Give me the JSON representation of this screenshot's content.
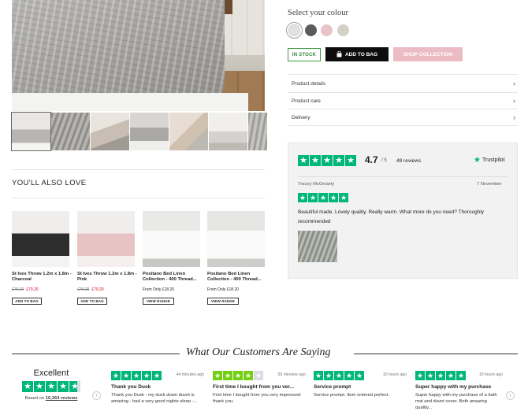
{
  "colour": {
    "title": "Select your colour",
    "swatches": [
      {
        "name": "light-grey",
        "hex": "#e3e1df",
        "selected": true
      },
      {
        "name": "charcoal",
        "hex": "#5a5a58"
      },
      {
        "name": "pink",
        "hex": "#e6c4c7"
      },
      {
        "name": "stone",
        "hex": "#d4d0c5"
      }
    ]
  },
  "actions": {
    "in_stock": "IN STOCK",
    "add_to_bag": "ADD TO BAG",
    "shop_collection": "SHOP COLLECTION"
  },
  "accordion": [
    "Product details",
    "Product care",
    "Delivery"
  ],
  "trustpilot": {
    "score": "4.7",
    "out_of": "/ 5",
    "reviews": "49 reviews",
    "brand": "Trustpilot",
    "reviewer": "Tracey McGroarty",
    "date": "7 November",
    "review": "Beautiful made. Lovely quality. Really warm. What more do you need? Thoroughly recommended"
  },
  "also_love": {
    "title": "YOU'LL ALSO LOVE",
    "products": [
      {
        "name": "St Ives Throw 1.2m x 1.8m - Charcoal",
        "was": "£79.20",
        "now": "£70.20",
        "button": "ADD TO BAG",
        "tone": "charcoal"
      },
      {
        "name": "St Ives Throw 1.2m x 1.8m - Pink",
        "was": "£79.20",
        "now": "£70.20",
        "button": "ADD TO BAG",
        "tone": "pink"
      },
      {
        "name": "Positano Bed Linen Collection - 400 Thread...",
        "from": "From Only £18.20",
        "button": "VIEW RANGE",
        "tone": "white"
      },
      {
        "name": "Positano Bed Linen Collection - 400 Thread...",
        "from": "From Only £18.20",
        "button": "VIEW RANGE",
        "tone": "white"
      }
    ]
  },
  "customers": {
    "heading": "What Our Customers Are Saying",
    "summary_label": "Excellent",
    "based_on_prefix": "Based on",
    "based_on_link": "16,364 reviews",
    "reviews": [
      {
        "rating": 5,
        "time": "44 minutes ago",
        "title": "Thank you Dusk",
        "text": "Thank you Dusk - my duck down duvet is amazing - had a very good nights sleep -..."
      },
      {
        "rating": 4,
        "time": "55 minutes ago",
        "title": "First time I bought from you ver...",
        "text": "First time I bought from you very impressed thank you."
      },
      {
        "rating": 5,
        "time": "10 hours ago",
        "title": "Service prompt",
        "text": "Service prompt. Item ordered perfect."
      },
      {
        "rating": 5,
        "time": "10 hours ago",
        "title": "Super happy with my purchase",
        "text": "Super happy with my purchase of a bath mat and duvet cover. Both amazing quality..."
      }
    ]
  }
}
